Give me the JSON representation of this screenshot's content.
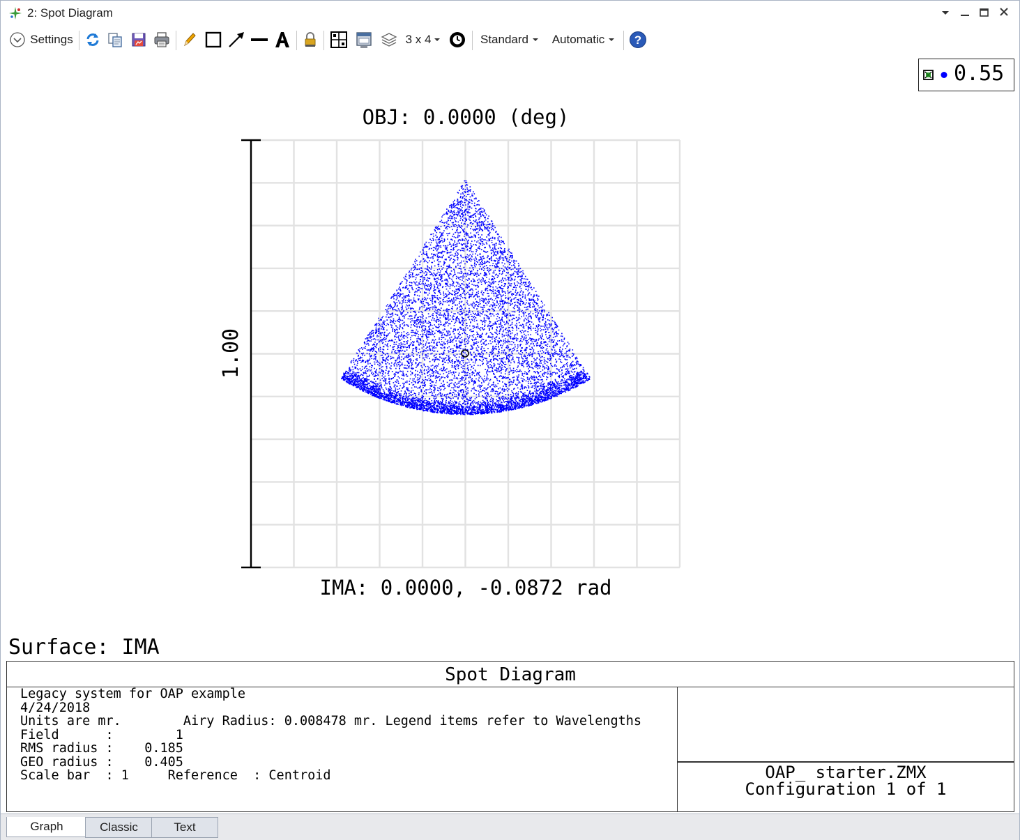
{
  "window": {
    "title": "2: Spot Diagram"
  },
  "toolbar": {
    "settings_label": "Settings",
    "layout_label": "3 x 4",
    "mode_label": "Standard",
    "scale_label": "Automatic",
    "icons": [
      "refresh-icon",
      "copy-icon",
      "save-icon",
      "print-icon",
      "pencil-icon",
      "rectangle-icon",
      "arrow-icon",
      "line-icon",
      "text-icon",
      "lock-icon",
      "grid-icon",
      "window-icon",
      "layers-icon",
      "clock-icon",
      "help-icon"
    ]
  },
  "legend": {
    "label": "0.55",
    "color": "#0000ff"
  },
  "plot": {
    "title": "OBJ: 0.0000 (deg)",
    "scale_bar_label": "1.00",
    "image_label": "IMA: 0.0000, -0.0872 rad",
    "spot_color": "#0000ff"
  },
  "surface_label": "Surface: IMA",
  "info": {
    "title": "Spot Diagram",
    "lines": [
      "Legacy system for OAP example",
      "4/24/2018",
      "Units are mr.        Airy Radius: 0.008478 mr. Legend items refer to Wavelengths",
      "Field      :        1",
      "RMS radius :    0.185",
      "GEO radius :    0.405",
      "Scale bar  : 1     Reference  : Centroid"
    ],
    "file_name": "OAP_ starter.ZMX",
    "configuration": "Configuration 1 of 1"
  },
  "tabs": [
    {
      "label": "Graph",
      "active": true
    },
    {
      "label": "Classic",
      "active": false
    },
    {
      "label": "Text",
      "active": false
    }
  ]
}
